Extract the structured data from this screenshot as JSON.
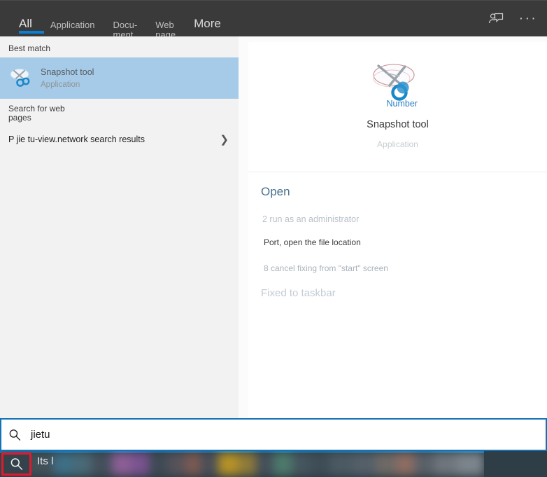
{
  "header": {
    "tabs": [
      {
        "label": "All",
        "active": true,
        "name": "tab-all"
      },
      {
        "label": "Application",
        "active": false,
        "name": "tab-application"
      },
      {
        "label": "Docu-\nment",
        "active": false,
        "name": "tab-document"
      },
      {
        "label": "Web\npage",
        "active": false,
        "name": "tab-webpage"
      },
      {
        "label": "More",
        "active": false,
        "name": "tab-more"
      }
    ],
    "feedback_icon": "person-feedback-icon",
    "overflow_label": "···",
    "background": "#3a3a3a",
    "accent": "#0a7fd4"
  },
  "sidebar": {
    "best_match_label": "Best match",
    "best_match": {
      "title": "Snapshot tool",
      "subtitle": "Application",
      "icon": "snipping-tool-scissors-icon",
      "highlight_color": "#a6cbe8"
    },
    "web_search_label": "Search for web\npages",
    "web_result": {
      "text": "P jie tu-view.network search results",
      "chevron": "❯"
    }
  },
  "details": {
    "app_icon": "snipping-tool-scissors-icon",
    "icon_overlay_text": "Number",
    "title": "Snapshot tool",
    "subtitle": "Application",
    "actions": [
      {
        "label": "Open",
        "style": "primary",
        "name": "action-open"
      },
      {
        "label": "2 run as an administrator",
        "style": "faded",
        "name": "action-run-as-administrator"
      },
      {
        "label": "Port, open the file location",
        "style": "normal",
        "name": "action-open-file-location"
      },
      {
        "label": "8 cancel fixing from \"start\" screen",
        "style": "faded2",
        "name": "action-unpin-from-start"
      },
      {
        "label": "Fixed to taskbar",
        "style": "big-faded",
        "name": "action-pin-to-taskbar"
      }
    ]
  },
  "search": {
    "icon": "search-icon",
    "value": "jietu",
    "placeholder": "jietu",
    "border_color": "#1273b8"
  },
  "taskbar": {
    "search_button_icon": "search-icon",
    "highlight_color": "#e2192c",
    "label": "Its l"
  }
}
